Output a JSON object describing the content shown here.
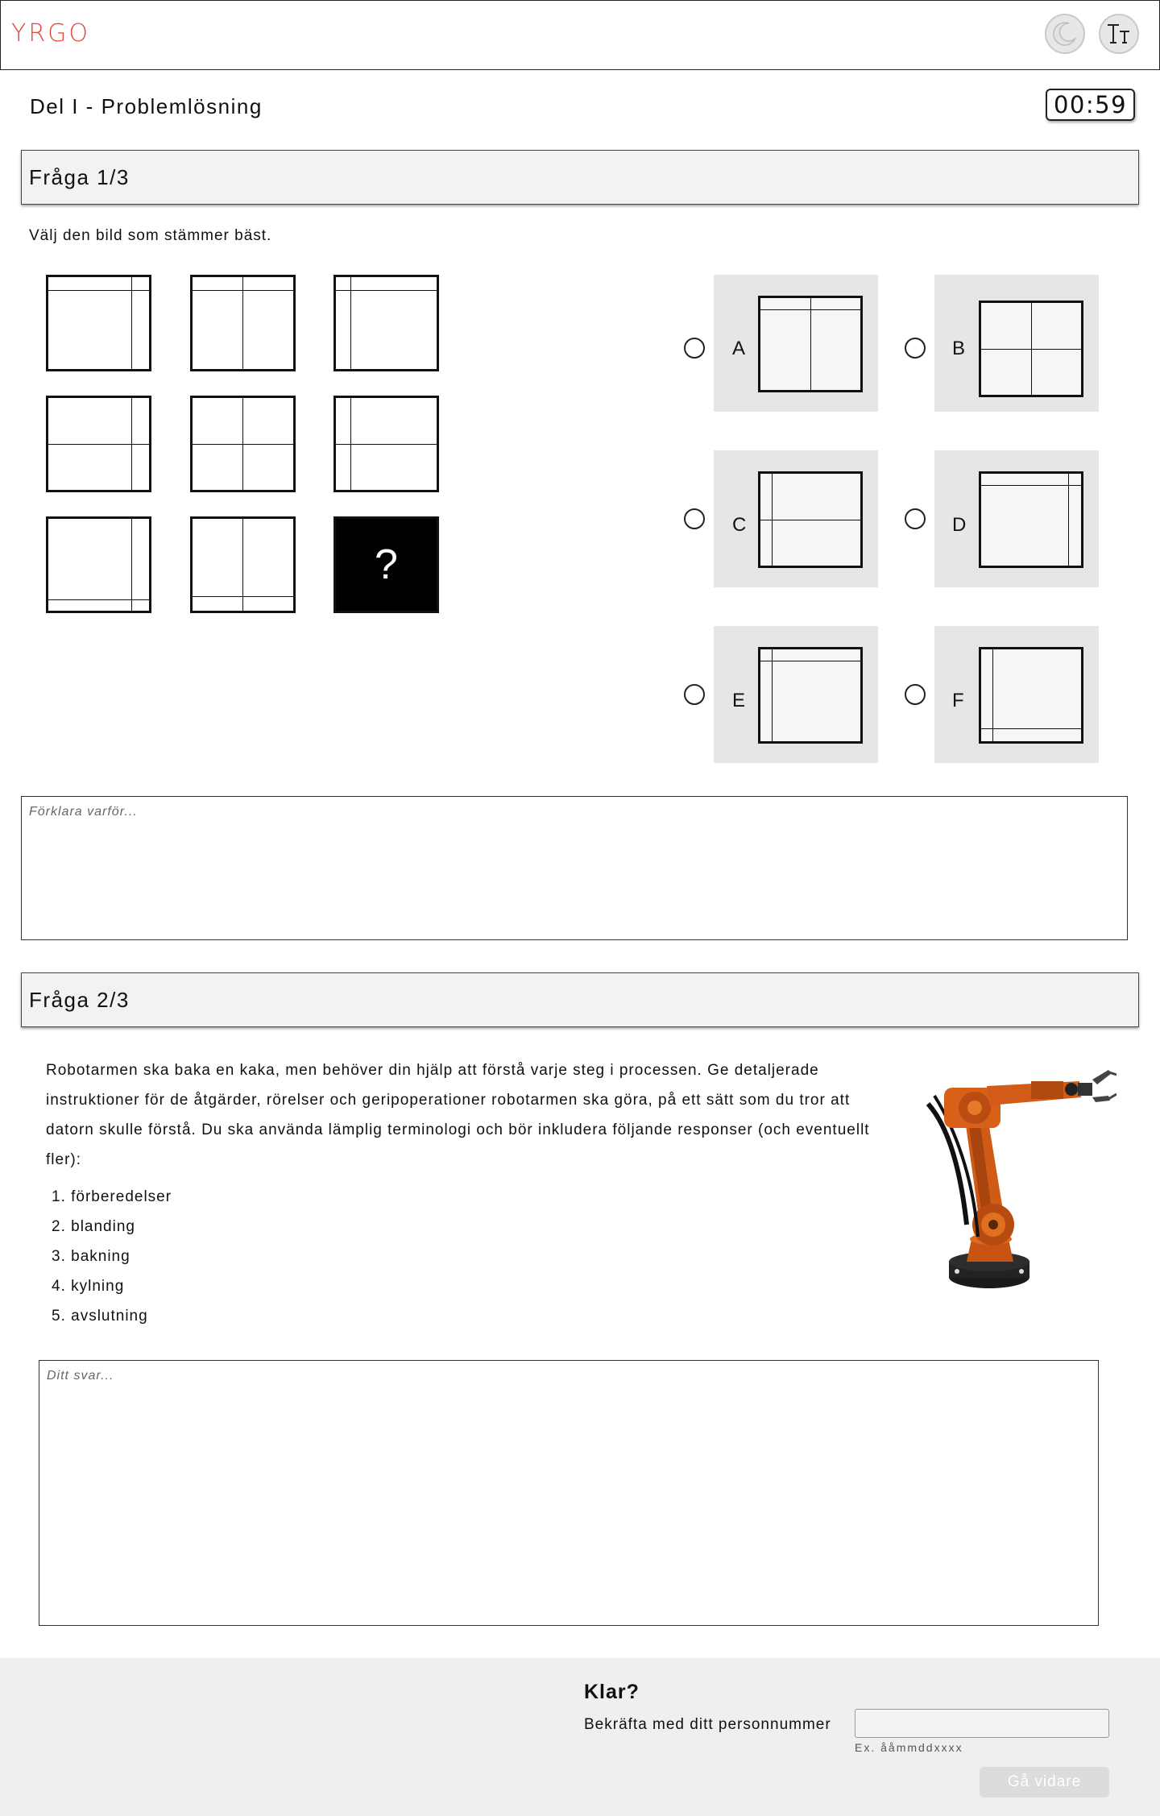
{
  "header": {
    "logo_text": "YRGO",
    "theme_icon": "moon-icon",
    "text_size_icon": "text-size-icon",
    "accent_color": "#e2483f"
  },
  "section": {
    "title": "Del I - Problemlösning",
    "timer": "00:59"
  },
  "question1": {
    "heading": "Fråga 1/3",
    "instruction": "Välj den bild som stämmer bäst.",
    "missing_cell_label": "?",
    "options": [
      {
        "letter": "A"
      },
      {
        "letter": "B"
      },
      {
        "letter": "C"
      },
      {
        "letter": "D"
      },
      {
        "letter": "E"
      },
      {
        "letter": "F"
      }
    ],
    "explain_placeholder": "Förklara varför..."
  },
  "question2": {
    "heading": "Fråga 2/3",
    "text": "Robotarmen ska baka en kaka, men behöver din hjälp att förstå varje steg i processen. Ge detaljerade instruktioner för de åtgärder, rörelser och geripoperationer robotarmen ska göra, på ett sätt som du tror att datorn skulle förstå. Du ska använda lämplig terminologi och bör inkludera följande responser (och eventuellt fler):",
    "steps": [
      "1. förberedelser",
      "2. blanding",
      "3. bakning",
      "4. kylning",
      "5. avslutning"
    ],
    "answer_placeholder": "Ditt svar..."
  },
  "footer": {
    "title": "Klar?",
    "confirm_label": "Bekräfta med ditt personnummer",
    "pnr_hint": "Ex. ååmmddxxxx",
    "next_button": "Gå vidare"
  }
}
